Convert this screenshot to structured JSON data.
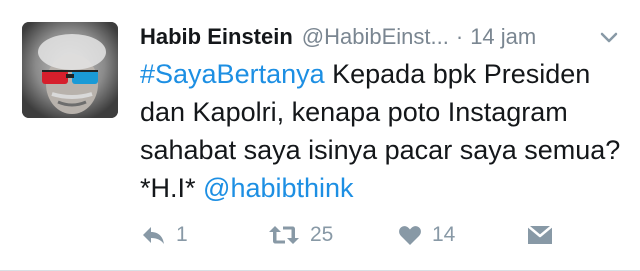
{
  "tweet": {
    "author_name": "Habib Einstein",
    "handle": "@HabibEinst...",
    "separator": "·",
    "time": "14 jam",
    "menu_icon": "chevron-down-icon",
    "text": {
      "hashtag": "#SayaBertanya",
      "body": " Kepada bpk Presiden dan Kapolri, kenapa poto Instagram sahabat saya isinya pacar saya semua? *H.I* ",
      "mention": "@habibthink"
    },
    "actions": {
      "reply": {
        "icon": "reply-icon",
        "count": "1"
      },
      "retweet": {
        "icon": "retweet-icon",
        "count": "25"
      },
      "like": {
        "icon": "heart-icon",
        "count": "14"
      },
      "dm": {
        "icon": "direct-message-icon"
      }
    }
  },
  "colors": {
    "link": "#1d8fe3",
    "text": "#14171a",
    "muted": "#7a8691",
    "icon": "#8899a6"
  }
}
